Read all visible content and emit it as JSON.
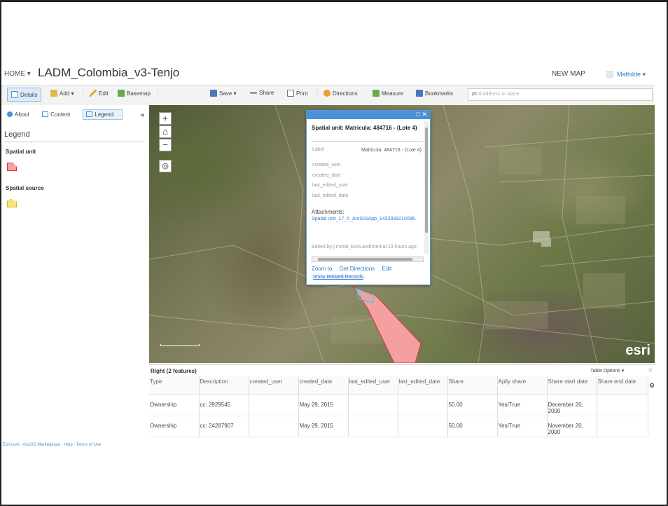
{
  "header": {
    "breadcrumb": "HOME ▾",
    "title": "LADM_Colombia_v3-Tenjo",
    "new_map": "NEW MAP",
    "user": "Mathilde ▾"
  },
  "toolbar": {
    "details": "Details",
    "add": "Add ▾",
    "edit": "Edit",
    "basemap": "Basemap",
    "save": "Save ▾",
    "share": "Share",
    "print": "Print",
    "directions": "Directions",
    "measure": "Measure",
    "bookmarks": "Bookmarks",
    "search_placeholder": "Find address or place"
  },
  "sidebar": {
    "tabs": [
      "About",
      "Content",
      "Legend"
    ],
    "legend_heading": "Legend",
    "layers": [
      "Spatial unit",
      "Spatial source"
    ],
    "footer": "Esri.com · ArcGIS Marketplace · Help · Terms of Use"
  },
  "popup": {
    "title": "Spatial unit: Matricula: 484716 - (Lote 4)",
    "fields": [
      {
        "name": "Label",
        "value": "Matricula: 484716 - (Lote 4)"
      },
      {
        "name": "created_user",
        "value": ""
      },
      {
        "name": "created_date",
        "value": ""
      },
      {
        "name": "last_edited_user",
        "value": ""
      },
      {
        "name": "last_edited_date",
        "value": ""
      }
    ],
    "attachments_label": "Attachments:",
    "attachment_link": "Spatial unit_17_0_ArcGISApp_1432839210096.",
    "edited_by": "Edited by j.moral_EsriLandInternal 23 hours ago",
    "zoom_to": "Zoom to",
    "get_directions": "Get Directions",
    "edit": "Edit",
    "show_related": "Show Related Records"
  },
  "map": {
    "logo": "esri"
  },
  "table": {
    "title": "Right (2 features)",
    "options": "Table Options ▾",
    "columns": [
      "Type",
      "Description",
      "created_user",
      "created_date",
      "last_edited_user",
      "last_edited_date",
      "Share",
      "Aplly share",
      "Share start date",
      "Share end date"
    ],
    "rows": [
      [
        "Ownership",
        "cc: 2929545",
        "",
        "May 29, 2015",
        "",
        "",
        "50.00",
        "Yes/True",
        "December 20, 2000",
        ""
      ],
      [
        "Ownership",
        "cc: 24287907",
        "",
        "May 29, 2015",
        "",
        "",
        "50.00",
        "Yes/True",
        "November 20, 2000",
        ""
      ]
    ]
  }
}
